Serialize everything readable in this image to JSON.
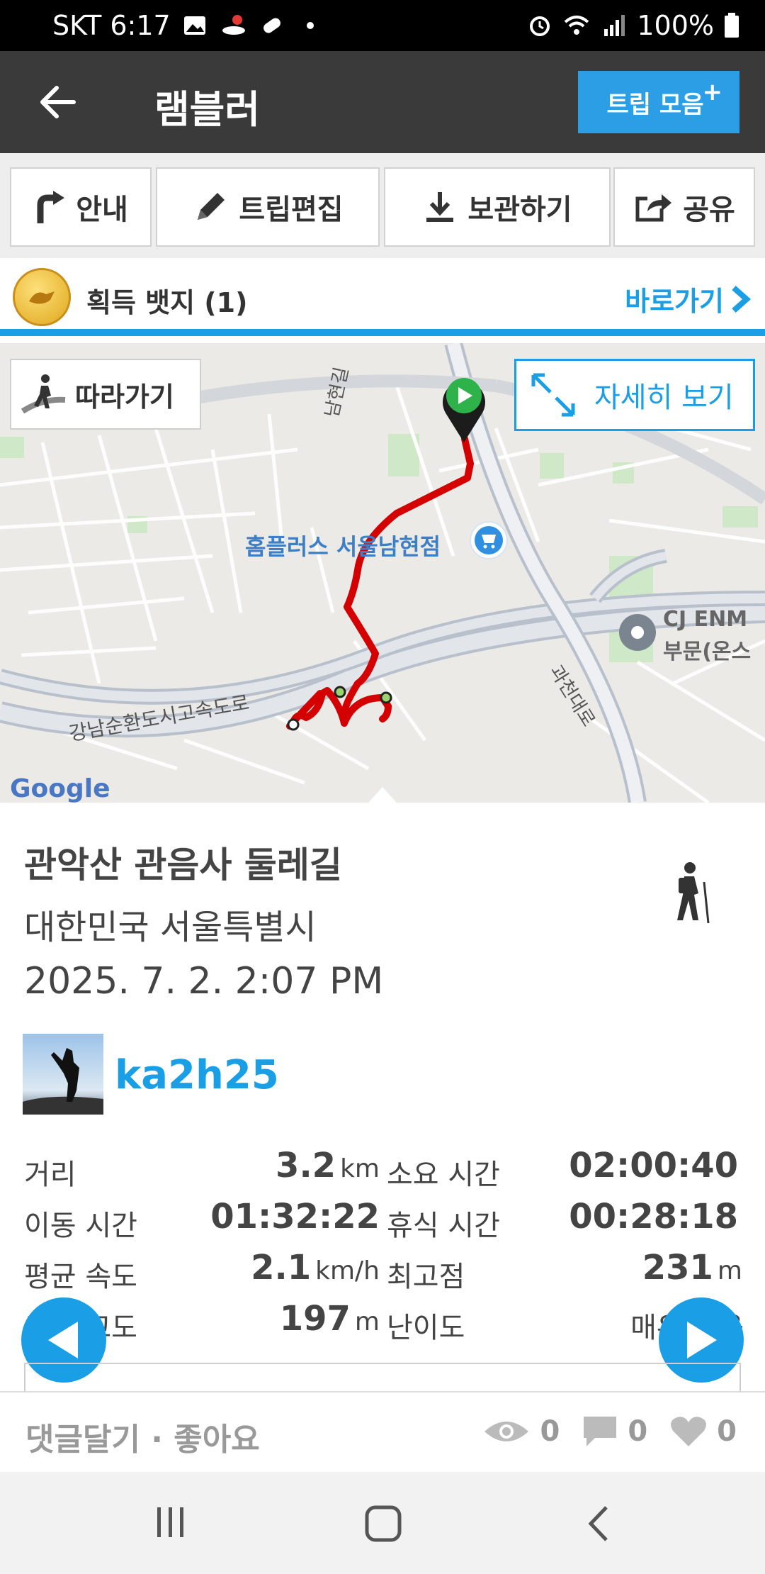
{
  "status_bar": {
    "carrier_time": "SKT 6:17",
    "battery": "100%",
    "icons": [
      "gallery-icon",
      "map-pin-icon",
      "pill-icon",
      "dot-icon",
      "alarm-icon",
      "wifi-icon",
      "signal-icon",
      "battery-icon"
    ]
  },
  "app_bar": {
    "title": "램블러",
    "trip_collection_label": "트립 모음",
    "trip_collection_plus": "+"
  },
  "toolbar": {
    "guide_label": "안내",
    "edit_label": "트립편집",
    "save_label": "보관하기",
    "share_label": "공유"
  },
  "badge": {
    "label": "획득 뱃지 (1)",
    "go_label": "바로가기"
  },
  "map": {
    "follow_label": "따라가기",
    "detail_label": "자세히 보기",
    "poi_label": "홈플러스 서울남현점",
    "cj_label_1": "CJ ENM",
    "cj_label_2": "부문(온스",
    "road_1": "강남순환도시고속도로",
    "road_2": "과천대로",
    "road_3": "남현길",
    "google": "Google",
    "route_color": "#d40000"
  },
  "trip": {
    "title": "관악산 관음사 둘레길",
    "location": "대한민국 서울특별시",
    "datetime": "2025. 7. 2. 2:07 PM",
    "username": "ka2h25",
    "activity_icon": "hiker-icon"
  },
  "stats": {
    "distance_label": "거리",
    "distance_value": "3.2",
    "distance_unit": "km",
    "duration_label": "소요 시간",
    "duration_value": "02:00:40",
    "moving_label": "이동 시간",
    "moving_value": "01:32:22",
    "rest_label": "휴식 시간",
    "rest_value": "00:28:18",
    "avg_speed_label": "평균 속도",
    "avg_speed_value": "2.1",
    "avg_speed_unit": "km/h",
    "max_alt_label": "최고점",
    "max_alt_value": "231",
    "max_alt_unit": "m",
    "gain_label": "총 등고도",
    "gain_value": "197",
    "gain_unit": "m",
    "difficulty_label": "난이도",
    "difficulty_value": "매우 쉬움"
  },
  "comment_bar": {
    "label": "댓글달기 · 좋아요",
    "views": "0",
    "comments": "0",
    "likes": "0"
  },
  "colors": {
    "accent": "#1a9ee5",
    "appbar": "#3a3a3a",
    "route": "#d40000"
  }
}
